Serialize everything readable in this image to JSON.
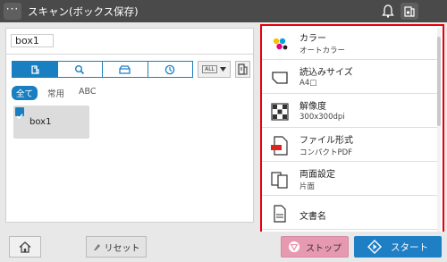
{
  "header": {
    "menu_label": "···",
    "title": "スキャン(ボックス保存)",
    "icons": [
      "bell-icon",
      "device-status-icon"
    ]
  },
  "left": {
    "box_label": "box1",
    "view_tabs": [
      "box-icon",
      "search-icon",
      "drawer-icon",
      "clock-icon"
    ],
    "dropdown_tag": "ALL",
    "filters": [
      "全て",
      "常用",
      "ABC"
    ],
    "box_item": "box1"
  },
  "settings": [
    {
      "icon": "color-dots-icon",
      "title": "カラー",
      "value": "オートカラー"
    },
    {
      "icon": "paper-size-icon",
      "title": "読込みサイズ",
      "value": "A4□"
    },
    {
      "icon": "resolution-grid-icon",
      "title": "解像度",
      "value": "300x300dpi"
    },
    {
      "icon": "pdf-file-icon",
      "title": "ファイル形式",
      "value": "コンパクトPDF"
    },
    {
      "icon": "duplex-icon",
      "title": "両面設定",
      "value": "片面"
    },
    {
      "icon": "document-name-icon",
      "title": "文書名",
      "value": ""
    }
  ],
  "bottom": {
    "reset_label": "リセット",
    "stop_label": "ストップ",
    "start_label": "スタート"
  },
  "colors": {
    "accent": "#1a7fc1",
    "highlight_border": "#e8000c",
    "stop": "#e899b2",
    "start": "#1e7fc4",
    "titlebar": "#4a4a4a"
  }
}
